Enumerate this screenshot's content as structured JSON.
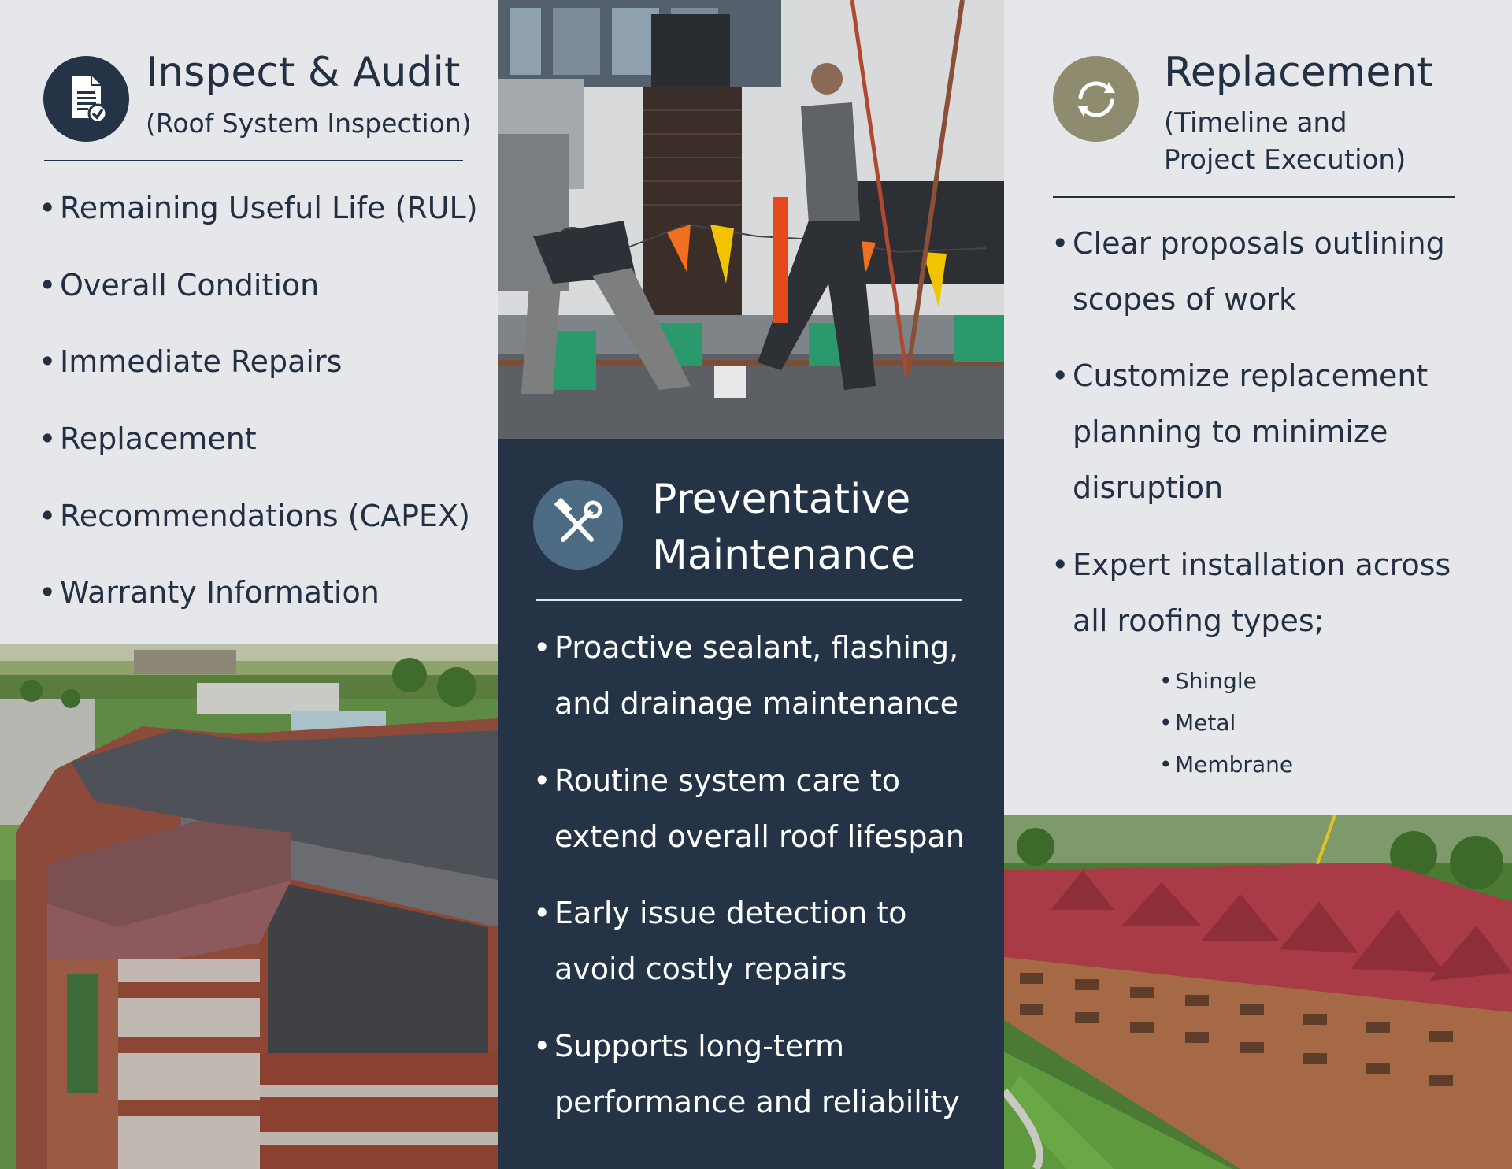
{
  "left": {
    "title": "Inspect & Audit",
    "subtitle": "(Roof System Inspection)",
    "icon": "document-check-icon",
    "bullets": [
      "Remaining Useful Life (RUL)",
      "Overall Condition",
      "Immediate Repairs",
      "Replacement",
      "Recommendations (CAPEX)",
      "Warranty Information"
    ]
  },
  "middle": {
    "title_line1": "Preventative",
    "title_line2": "Maintenance",
    "icon": "hammer-wrench-icon",
    "bullets": [
      {
        "line1": "Proactive sealant, flashing,",
        "line2": "and drainage maintenance"
      },
      {
        "line1": "Routine system care to",
        "line2": "extend overall roof lifespan"
      },
      {
        "line1": "Early issue detection to",
        "line2": "avoid costly repairs"
      },
      {
        "line1": "Supports long-term",
        "line2": "performance and reliability"
      }
    ]
  },
  "right": {
    "title": "Replacement",
    "subtitle_line1": "(Timeline and",
    "subtitle_line2": "Project Execution)",
    "icon": "refresh-arrows-icon",
    "bullets": [
      {
        "lines": [
          "Clear proposals outlining",
          "scopes of work"
        ]
      },
      {
        "lines": [
          "Customize replacement",
          "planning to minimize",
          "disruption"
        ]
      },
      {
        "lines": [
          "Expert installation across",
          "all roofing types;"
        ]
      }
    ],
    "roof_types": [
      "Shingle",
      "Metal",
      "Membrane"
    ]
  },
  "colors": {
    "navy": "#243346",
    "panel": "#e6e7ea",
    "icon_blue": "#4d6b82",
    "icon_olive": "#8e8b6f"
  }
}
